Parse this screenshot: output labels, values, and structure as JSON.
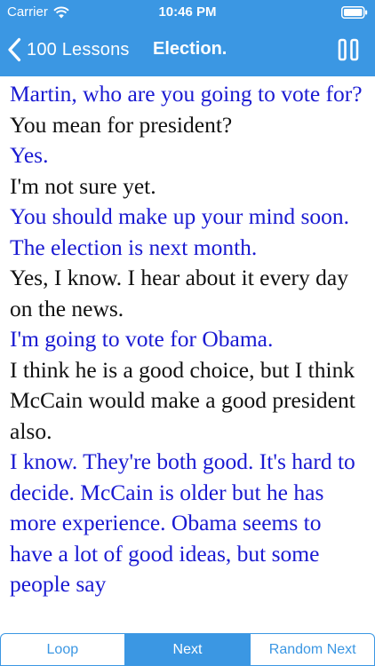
{
  "status_bar": {
    "carrier": "Carrier",
    "time": "10:46 PM",
    "wifi_icon": "wifi-icon",
    "battery_icon": "battery-icon"
  },
  "nav": {
    "back_label": "100 Lessons",
    "title": "Election.",
    "back_icon": "chevron-left-icon",
    "pause_icon": "pause-icon",
    "accent_color": "#3b97e3"
  },
  "lesson": {
    "speaker_a_color": "#1a1ad2",
    "speaker_b_color": "#111111",
    "lines": [
      {
        "speaker": "a",
        "text": "Martin, who are you going to vote for?"
      },
      {
        "speaker": "b",
        "text": "You mean for president?"
      },
      {
        "speaker": "a",
        "text": "Yes."
      },
      {
        "speaker": "b",
        "text": "I'm not sure yet."
      },
      {
        "speaker": "a",
        "text": "You should make up your mind soon. The election is next month."
      },
      {
        "speaker": "b",
        "text": "Yes, I know. I hear about it every day on the news."
      },
      {
        "speaker": "a",
        "text": "I'm going to vote for Obama."
      },
      {
        "speaker": "b",
        "text": "I think he is a good choice, but I think McCain would make a good president also."
      },
      {
        "speaker": "a",
        "text": "I know. They're both good. It's hard to decide. McCain is older but he has more experience. Obama seems to have a lot of good ideas, but some people say"
      }
    ]
  },
  "toolbar": {
    "loop_label": "Loop",
    "next_label": "Next",
    "random_next_label": "Random Next",
    "selected": "Next"
  }
}
